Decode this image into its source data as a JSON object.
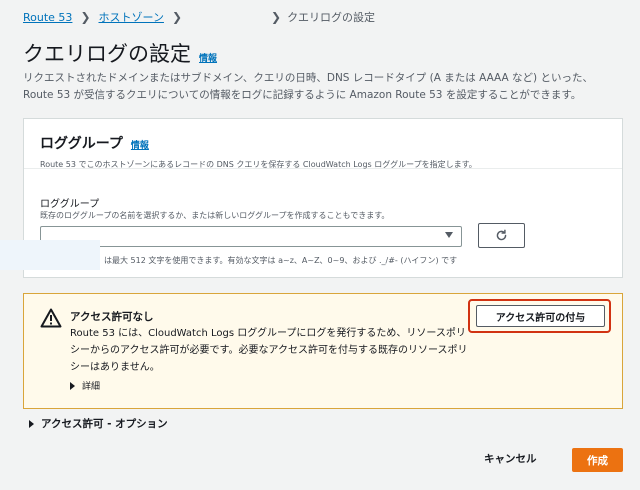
{
  "breadcrumb": {
    "items": [
      "Route 53",
      "ホストゾーン"
    ],
    "current": "クエリログの設定"
  },
  "page": {
    "title": "クエリログの設定",
    "info_label": "情報",
    "description": "リクエストされたドメインまたはサブドメイン、クエリの日時、DNS レコードタイプ (A または AAAA など) といった、Route 53 が受信するクエリについての情報をログに記録するように Amazon Route 53 を設定することができます。"
  },
  "log_group": {
    "title": "ロググループ",
    "info_label": "情報",
    "description": "Route 53 でこのホストゾーンにあるレコードの DNS クエリを保存する CloudWatch Logs ロググループを指定します。",
    "field_label": "ロググループ",
    "field_description": "既存のロググループの名前を選択するか、または新しいロググループを作成することもできます。",
    "select_value": "",
    "constraint_text": "は最大 512 文字を使用できます。有効な文字は a~z、A~Z、0~9、および ._/#- (ハイフン) です"
  },
  "warning": {
    "title": "アクセス許可なし",
    "body": "Route 53 には、CloudWatch Logs ロググループにログを発行するため、リソースポリシーからのアクセス許可が必要です。必要なアクセス許可を付与する既存のリソースポリシーはありません。",
    "details_label": "詳細",
    "grant_button": "アクセス許可の付与"
  },
  "access_section": {
    "label": "アクセス許可 - オプション"
  },
  "footer": {
    "cancel_label": "キャンセル",
    "create_label": "作成"
  },
  "colors": {
    "link": "#0073bb",
    "primary": "#ec7211",
    "warning_border": "#d9a53a",
    "highlight": "#d13212"
  },
  "icons": [
    "chevron-right-icon",
    "caret-down-icon",
    "refresh-icon",
    "warning-icon",
    "triangle-right-icon"
  ]
}
